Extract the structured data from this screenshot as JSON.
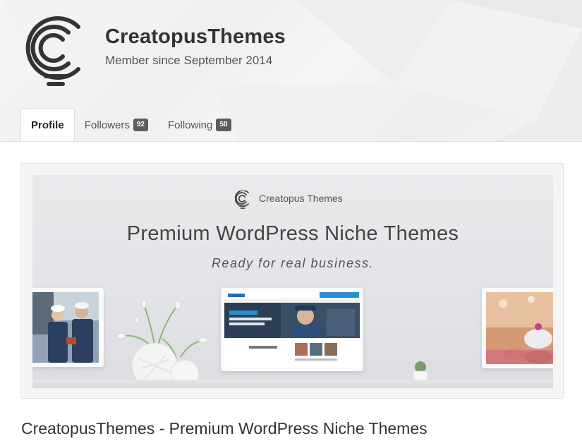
{
  "profile": {
    "name": "CreatopusThemes",
    "member_since": "Member since September 2014"
  },
  "tabs": [
    {
      "label": "Profile",
      "count": null,
      "active": true
    },
    {
      "label": "Followers",
      "count": "92",
      "active": false
    },
    {
      "label": "Following",
      "count": "50",
      "active": false
    }
  ],
  "banner": {
    "brand": "Creatopus Themes",
    "title": "Premium WordPress Niche Themes",
    "tagline": "Ready for real business."
  },
  "page_title": "CreatopusThemes - Premium WordPress Niche Themes",
  "colors": {
    "badge": "#5c5c5c",
    "accent_blue": "#2a8fd0"
  },
  "icons": {
    "logo": "concentric-lightbulb-logo"
  }
}
